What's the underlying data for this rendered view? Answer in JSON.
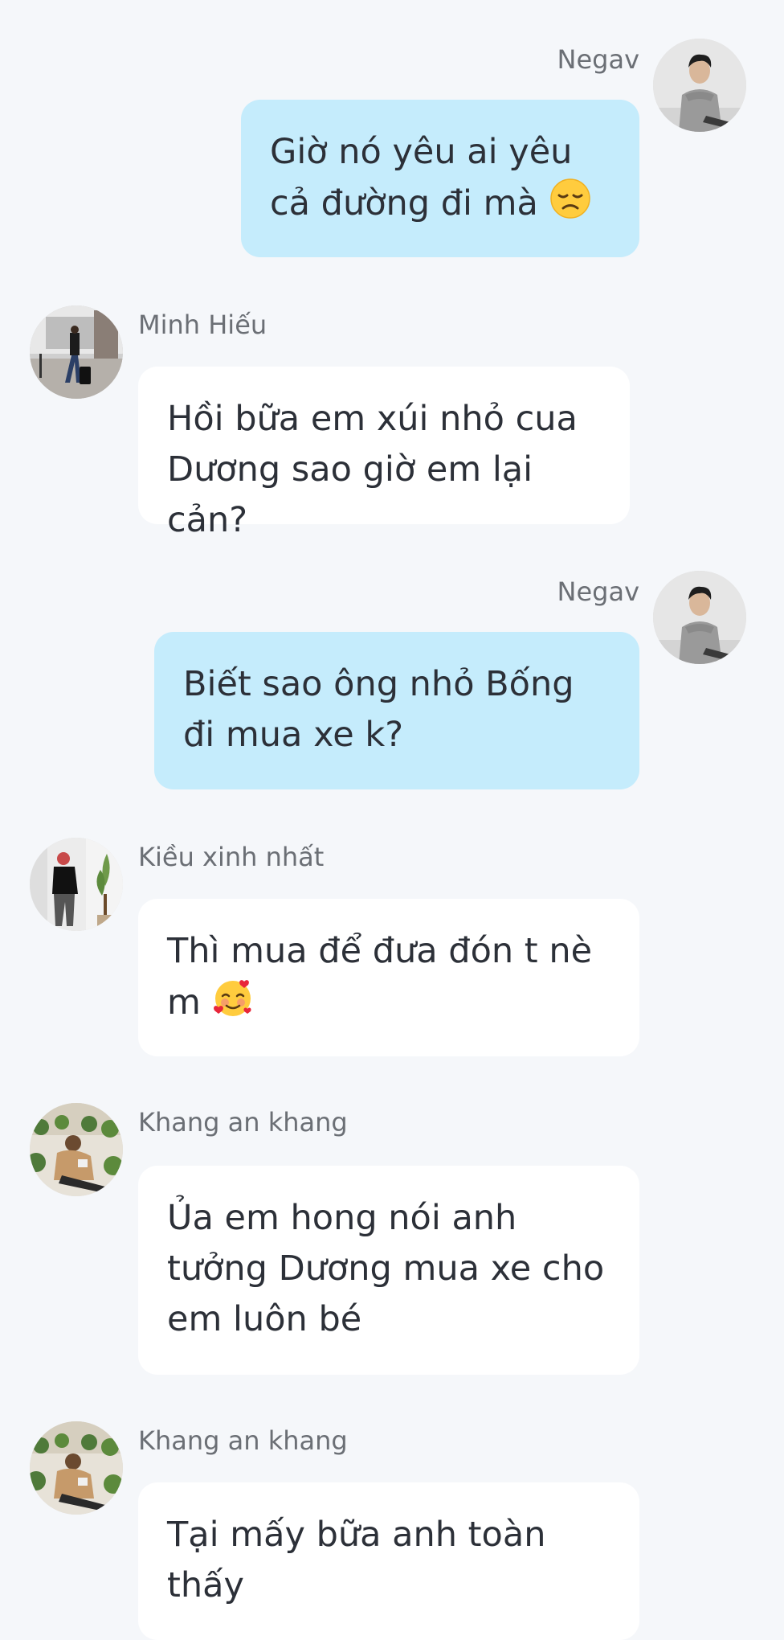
{
  "messages": [
    {
      "direction": "outgoing",
      "sender": "Negav",
      "avatar_icon": "negav-avatar",
      "text": "Giờ nó yêu ai yêu cả đường đi mà",
      "emoji": "disappointed-face-icon"
    },
    {
      "direction": "incoming",
      "sender": "Minh Hiếu",
      "avatar_icon": "minh-hieu-avatar",
      "text": "Hồi bữa em xúi nhỏ cua Dương sao giờ em lại cản?"
    },
    {
      "direction": "outgoing",
      "sender": "Negav",
      "avatar_icon": "negav-avatar",
      "text": "Biết sao ông nhỏ Bống đi mua xe k?"
    },
    {
      "direction": "incoming",
      "sender": "Kiều xinh nhất",
      "avatar_icon": "kieu-avatar",
      "text": "Thì mua để đưa đón t nè m",
      "emoji": "smiling-face-with-hearts-icon"
    },
    {
      "direction": "incoming",
      "sender": "Khang an khang",
      "avatar_icon": "khang-avatar",
      "text": "Ủa em hong nói anh tưởng Dương mua xe cho em luôn bé"
    },
    {
      "direction": "incoming",
      "sender": "Khang an khang",
      "avatar_icon": "khang-avatar",
      "text": "Tại mấy bữa anh toàn thấy"
    }
  ],
  "colors": {
    "background": "#f5f7fa",
    "outgoing_bubble": "#c5ecfc",
    "incoming_bubble": "#ffffff",
    "sender_name": "#6b6f75",
    "message_text": "#2c3038"
  }
}
